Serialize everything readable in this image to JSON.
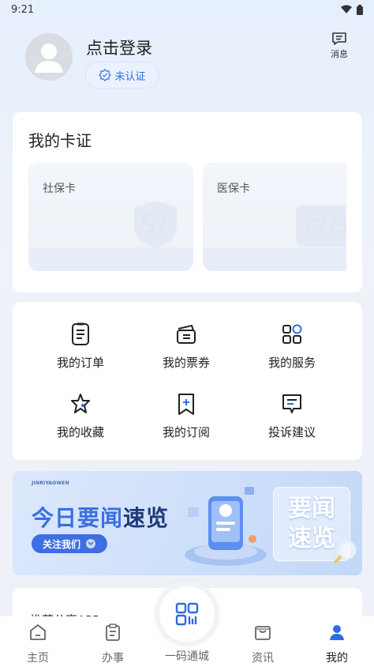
{
  "status_bar": {
    "time": "9:21"
  },
  "profile": {
    "login_text": "点击登录",
    "auth_badge": "未认证",
    "message_label": "消息"
  },
  "cards": {
    "title": "我的卡证",
    "items": [
      {
        "label": "社保卡",
        "watermark": "SI"
      },
      {
        "label": "医保卡",
        "watermark": "CHS"
      }
    ]
  },
  "services": [
    {
      "label": "我的订单",
      "icon": "order-icon"
    },
    {
      "label": "我的票券",
      "icon": "ticket-icon"
    },
    {
      "label": "我的服务",
      "icon": "service-icon"
    },
    {
      "label": "我的收藏",
      "icon": "star-icon"
    },
    {
      "label": "我的订阅",
      "icon": "subscribe-icon"
    },
    {
      "label": "投诉建议",
      "icon": "feedback-icon"
    }
  ],
  "banner": {
    "small_text": "JINRIYAOWEN",
    "title_a": "今日要闻",
    "title_b": "速览",
    "follow": "关注我们",
    "box_line1": "要闻",
    "box_line2": "速览"
  },
  "partial_card": {
    "text": "推荐分享APP"
  },
  "tabbar": {
    "items": [
      {
        "label": "主页",
        "icon": "home-icon"
      },
      {
        "label": "办事",
        "icon": "clipboard-icon"
      },
      {
        "label": "一码通城",
        "icon": "qrcode-icon"
      },
      {
        "label": "资讯",
        "icon": "news-bag-icon"
      },
      {
        "label": "我的",
        "icon": "person-icon"
      }
    ],
    "active_index": 4
  },
  "colors": {
    "accent": "#2e6be6",
    "background": "#eef2f8"
  }
}
